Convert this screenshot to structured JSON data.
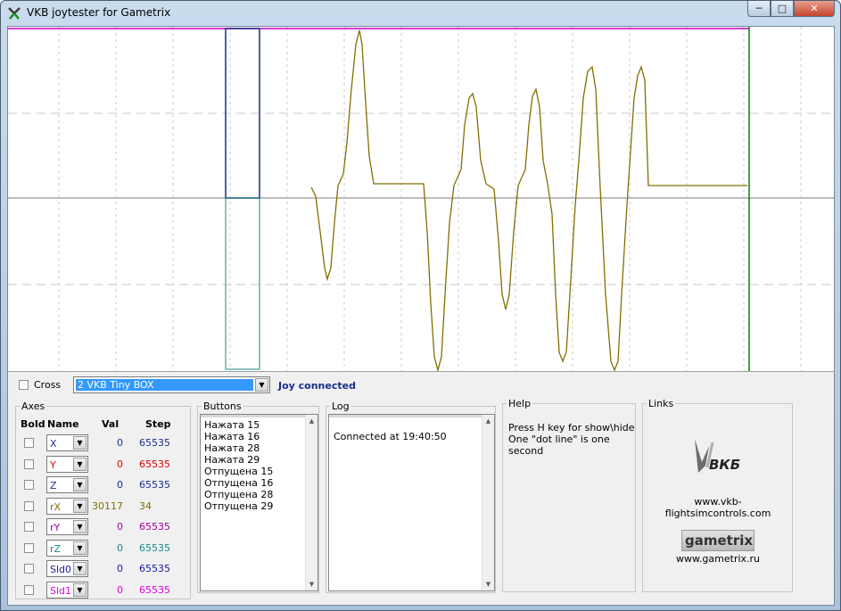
{
  "window": {
    "title": "VKB joytester for Gametrix",
    "minimize_glyph": "─",
    "maximize_glyph": "□",
    "close_glyph": "✕"
  },
  "graph": {
    "grid_color": "#c8c8c8",
    "center_line_color": "#a8a8a8",
    "trace_color": "#807000",
    "top_line_color": "#c000c0",
    "marker_line_color": "#008000",
    "bar_color_upper": "#1c2a8c",
    "bar_color_lower": "#1a8a8a"
  },
  "controls": {
    "cross_label": "Cross",
    "device_selected": "2 VKB Tiny BOX",
    "dropdown_glyph": "▼",
    "status": "Joy connected"
  },
  "axes": {
    "title": "Axes",
    "headers": {
      "bold": "Bold",
      "name": "Name",
      "val": "Val",
      "step": "Step"
    },
    "rows": [
      {
        "name": "X",
        "val": "0",
        "step": "65535",
        "color": "#1a2e8c"
      },
      {
        "name": "Y",
        "val": "0",
        "step": "65535",
        "color": "#e00000"
      },
      {
        "name": "Z",
        "val": "0",
        "step": "65535",
        "color": "#1a2e8c"
      },
      {
        "name": "rX",
        "val": "30117",
        "step": "34",
        "color": "#807000"
      },
      {
        "name": "rY",
        "val": "0",
        "step": "65535",
        "color": "#a000a0"
      },
      {
        "name": "rZ",
        "val": "0",
        "step": "65535",
        "color": "#1a8a8a"
      },
      {
        "name": "Sld0",
        "val": "0",
        "step": "65535",
        "color": "#1a1aa0"
      },
      {
        "name": "Sld1",
        "val": "0",
        "step": "65535",
        "color": "#e000e0"
      }
    ]
  },
  "buttons": {
    "title": "Buttons",
    "items": [
      "Нажата 15",
      "Нажата 16",
      "Нажата 28",
      "Нажата 29",
      "Отпущена 15",
      "Отпущена 16",
      "Отпущена 28",
      "Отпущена 29"
    ]
  },
  "log": {
    "title": "Log",
    "items": [
      "Connected at 19:40:50"
    ]
  },
  "help": {
    "title": "Help",
    "line1": "Press H key for show\\hide",
    "line2": "One \"dot line\" is one second"
  },
  "links": {
    "title": "Links",
    "vkb_logo_text": "ВКБ",
    "vkb_url": "www.vkb-flightsimcontrols.com",
    "gametrix_logo_text": "gametrix",
    "gametrix_url": "www.gametrix.ru"
  },
  "scroll": {
    "up_glyph": "▲",
    "down_glyph": "▼"
  }
}
